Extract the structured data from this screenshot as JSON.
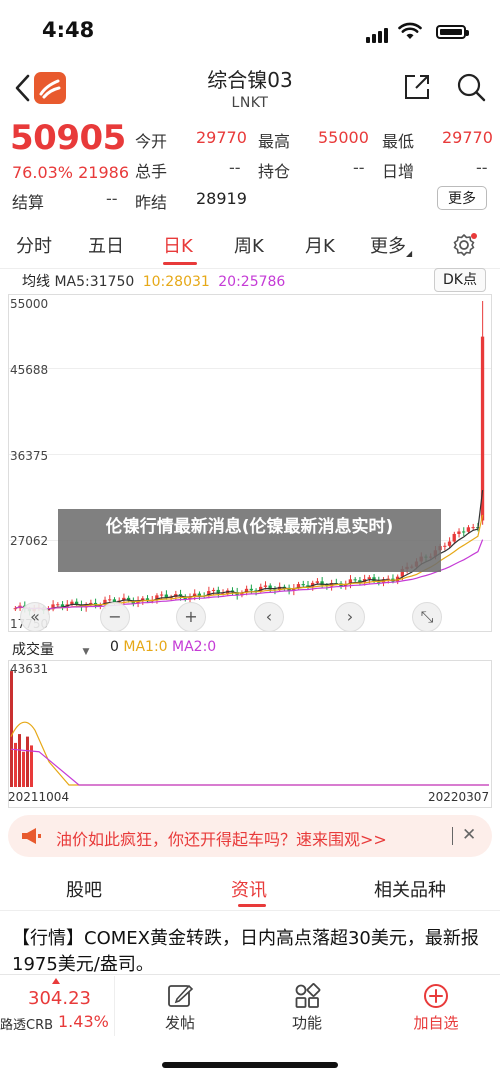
{
  "status_bar": {
    "time": "4:48"
  },
  "header": {
    "title": "综合镍03",
    "subtitle": "LNKT"
  },
  "quote": {
    "price": "50905",
    "change_pct": "76.03%",
    "change_val": "21986",
    "fields": [
      {
        "label": "今开",
        "value": "29770"
      },
      {
        "label": "最高",
        "value": "55000"
      },
      {
        "label": "最低",
        "value": "29770"
      },
      {
        "label": "总手",
        "value": "--"
      },
      {
        "label": "持仓",
        "value": "--"
      },
      {
        "label": "日增",
        "value": "--"
      },
      {
        "label": "结算",
        "value": "--"
      },
      {
        "label": "昨结",
        "value": "28919"
      }
    ],
    "more_label": "更多"
  },
  "period_tabs": [
    "分时",
    "五日",
    "日K",
    "周K",
    "月K",
    "更多"
  ],
  "active_period": "日K",
  "chart_header": {
    "ma_label": "均线",
    "ma5": "MA5:31750",
    "ma10": "10:28031",
    "ma20": "20:25786",
    "dk_button": "DK点"
  },
  "colors": {
    "up": "#e83a3a",
    "down": "#1aa34a",
    "ma5": "#333333",
    "ma10": "#e6a817",
    "ma20": "#c53bd6",
    "accent": "#e83a3a"
  },
  "chart_data": {
    "type": "candlestick",
    "y_ticks": [
      "55000",
      "45688",
      "36375",
      "27062",
      "17750"
    ],
    "ylim": [
      17750,
      55000
    ],
    "x_start": "20211004",
    "x_end": "20220307",
    "last_high": 55000,
    "last_close": 50905,
    "ma_lines": [
      "MA5",
      "MA10",
      "MA20"
    ]
  },
  "volume": {
    "label": "成交量",
    "zero": "0",
    "ma1": "MA1:0",
    "ma2": "MA2:0",
    "max_tick": "43631",
    "date_start": "20211004",
    "date_end": "20220307"
  },
  "overlay_title": "伦镍行情最新消息(伦镍最新消息实时)",
  "ad": {
    "text": "油价如此疯狂，你还开得起车吗？速来围观>>"
  },
  "news_tabs": [
    "股吧",
    "资讯",
    "相关品种"
  ],
  "active_news_tab": "资讯",
  "news_item": "【行情】COMEX黄金转跌，日内高点落超30美元，最新报1975美元/盎司。",
  "bottom_bar": {
    "ticker_price": "304.23",
    "ticker_name": "路透CRB",
    "ticker_pct": "1.43%",
    "post_label": "发帖",
    "func_label": "功能",
    "watch_label": "加自选"
  }
}
